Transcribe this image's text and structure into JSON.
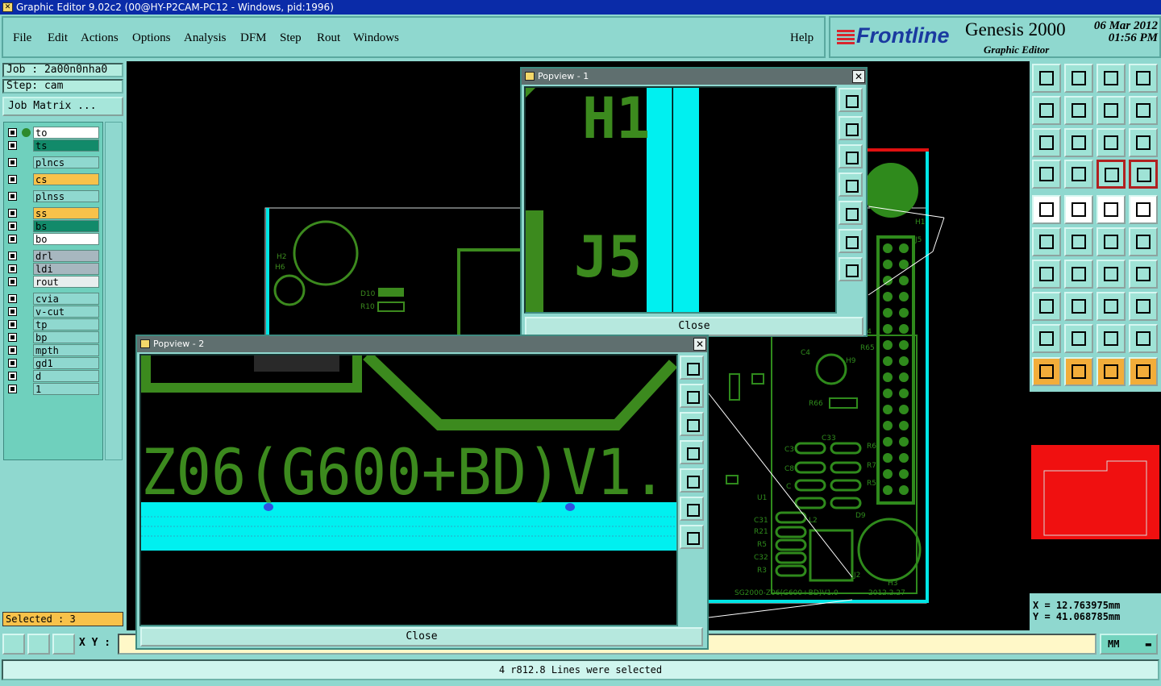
{
  "window": {
    "title": "Graphic Editor 9.02c2 (00@HY-P2CAM-PC12 - Windows, pid:1996)"
  },
  "menu": {
    "file": "File",
    "edit": "Edit",
    "actions": "Actions",
    "options": "Options",
    "analysis": "Analysis",
    "dfm": "DFM",
    "step": "Step",
    "rout": "Rout",
    "windows": "Windows",
    "help": "Help"
  },
  "brand": {
    "logo": "Frontline",
    "product": "Genesis 2000",
    "subtitle": "Graphic Editor",
    "date": "06 Mar 2012",
    "time": "01:56 PM"
  },
  "job": {
    "job": "Job : 2a00n0nha0",
    "step": "Step: cam",
    "matrix": "Job Matrix ..."
  },
  "layers": [
    {
      "name": "to",
      "color": "#ffffff"
    },
    {
      "name": "ts",
      "color": "#128a6a"
    },
    {
      "name": "plncs",
      "color": "#8fd8cf"
    },
    {
      "name": "cs",
      "color": "#f8c24a"
    },
    {
      "name": "plnss",
      "color": "#8fd8cf"
    },
    {
      "name": "ss",
      "color": "#f8c24a"
    },
    {
      "name": "bs",
      "color": "#128a6a"
    },
    {
      "name": "bo",
      "color": "#ffffff"
    },
    {
      "name": "drl",
      "color": "#a7b7bf"
    },
    {
      "name": "ldi",
      "color": "#a7b7bf"
    },
    {
      "name": "rout",
      "color": "#e8eeee"
    },
    {
      "name": "cvia",
      "color": "#8fd8cf"
    },
    {
      "name": "v-cut",
      "color": "#8fd8cf"
    },
    {
      "name": "tp",
      "color": "#8fd8cf"
    },
    {
      "name": "bp",
      "color": "#8fd8cf"
    },
    {
      "name": "mpth",
      "color": "#8fd8cf"
    },
    {
      "name": "gd1",
      "color": "#8fd8cf"
    },
    {
      "name": "d",
      "color": "#8fd8cf"
    },
    {
      "name": "1",
      "color": "#8fd8cf"
    }
  ],
  "selected": "Selected : 3",
  "coords": {
    "x": "X = 12.763975mm",
    "y": "Y = 41.068785mm"
  },
  "bottom": {
    "xy_label": "X Y :",
    "units": "MM"
  },
  "status": "4 r812.8 Lines were selected",
  "popup1": {
    "title": "Popview - 1",
    "close": "Close",
    "text_h1": "H1",
    "text_j5": "J5"
  },
  "popup2": {
    "title": "Popview - 2",
    "close": "Close",
    "text_main": "Z06(G600+BD)V1."
  },
  "board": {
    "h2": "H2",
    "h6": "H6",
    "d10": "D10",
    "r10": "R10",
    "c4": "C4",
    "r65": "R65",
    "h9": "H9",
    "r66": "R66",
    "c33": "C33",
    "c3": "C3",
    "c8": "C8",
    "c": "C",
    "u1": "U1",
    "c31": "C31",
    "r21": "R21",
    "r5": "R5",
    "c32": "C32",
    "r3": "R3",
    "l2": "L2",
    "d9": "D9",
    "h3": "H3",
    "j2": "J2",
    "r6": "R6",
    "r7": "R7",
    "r5b": "R5",
    "j5": "J5",
    "h1": "H1",
    "r4": "R4",
    "footer": "SG2000-Z06(G600+BD)V1.0",
    "date": "2012.2.27"
  },
  "colors": {
    "trace": "#3c8a1e",
    "copper": "#2f8a1c",
    "cyan": "#00f0f0",
    "minimap": "#f01010"
  }
}
